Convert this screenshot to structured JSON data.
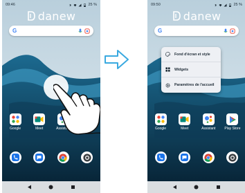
{
  "left_screen": {
    "status": {
      "time": "09:46",
      "battery": "25 %"
    },
    "brand": "danew",
    "apps": [
      {
        "label": "Google",
        "icon": "google-folder-icon"
      },
      {
        "label": "Meet",
        "icon": "meet-icon"
      },
      {
        "label": "Assistant",
        "icon": "assistant-icon"
      },
      {
        "label": "",
        "icon": "play-store-icon"
      }
    ],
    "dock": [
      {
        "icon": "phone-icon"
      },
      {
        "icon": "messages-icon"
      },
      {
        "icon": "chrome-icon"
      },
      {
        "icon": "camera-icon"
      }
    ]
  },
  "right_screen": {
    "status": {
      "time": "09:50",
      "battery": "25 %"
    },
    "brand": "danew",
    "menu": [
      {
        "label": "Fond d'écran et style",
        "icon": "palette-icon"
      },
      {
        "label": "Widgets",
        "icon": "widgets-icon"
      },
      {
        "label": "Paramètres de l'accueil",
        "icon": "settings-gear-icon"
      }
    ],
    "apps": [
      {
        "label": "Google",
        "icon": "google-folder-icon"
      },
      {
        "label": "Meet",
        "icon": "meet-icon"
      },
      {
        "label": "Assistant",
        "icon": "assistant-icon"
      },
      {
        "label": "Play Store",
        "icon": "play-store-icon"
      }
    ],
    "dock": [
      {
        "icon": "phone-icon"
      },
      {
        "icon": "messages-icon"
      },
      {
        "icon": "chrome-icon"
      },
      {
        "icon": "camera-icon"
      }
    ]
  },
  "colors": {
    "sky": "#c9d9e3",
    "wave": "#2d7fa6",
    "sea": "#0b2f44",
    "accent_blue": "#4285f4",
    "arrow": "#39a9e0"
  }
}
